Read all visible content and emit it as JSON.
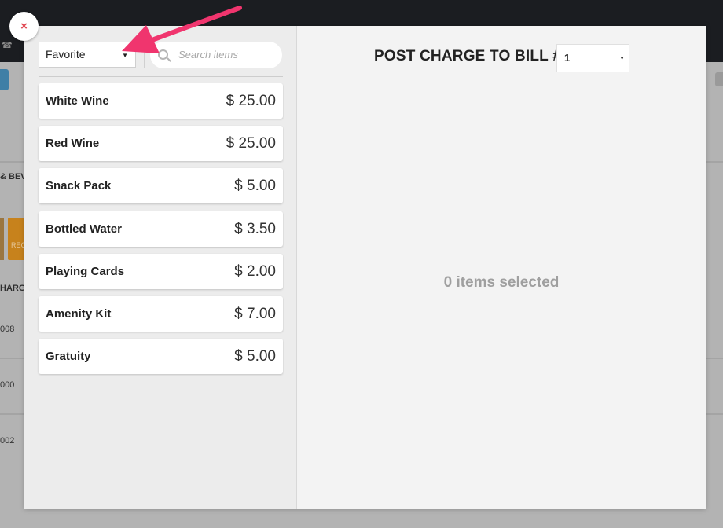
{
  "background": {
    "partial_labels": [
      "& BEVE",
      "HARGI"
    ],
    "partial_numbers": [
      "008",
      "000",
      "002"
    ],
    "orange_button_text": "REG"
  },
  "modal": {
    "close_icon": "×",
    "category": {
      "value": "Favorite",
      "caret": "▼"
    },
    "search": {
      "placeholder": "Search items"
    },
    "items": [
      {
        "name": "White Wine",
        "price": "$ 25.00"
      },
      {
        "name": "Red Wine",
        "price": "$ 25.00"
      },
      {
        "name": "Snack Pack",
        "price": "$ 5.00"
      },
      {
        "name": "Bottled Water",
        "price": "$ 3.50"
      },
      {
        "name": "Playing Cards",
        "price": "$ 2.00"
      },
      {
        "name": "Amenity Kit",
        "price": "$ 7.00"
      },
      {
        "name": "Gratuity",
        "price": "$ 5.00"
      }
    ],
    "post_charge": {
      "label": "POST CHARGE TO BILL #",
      "bill_value": "1",
      "caret": "▼"
    },
    "empty_message": "0 items selected"
  },
  "colors": {
    "arrow": "#f0356e",
    "close_icon": "#e0454f",
    "topbar": "#1b1d21"
  }
}
